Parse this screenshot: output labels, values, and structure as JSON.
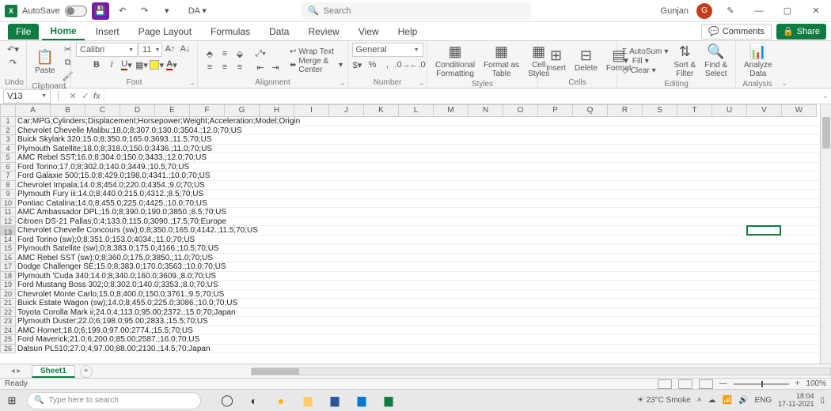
{
  "titlebar": {
    "autosave_label": "AutoSave",
    "autosave_state": "Off",
    "doc_name": "DA ▾",
    "search_placeholder": "Search",
    "user_name": "Gunjan",
    "user_initial": "G"
  },
  "tabs": {
    "file": "File",
    "items": [
      "Home",
      "Insert",
      "Page Layout",
      "Formulas",
      "Data",
      "Review",
      "View",
      "Help"
    ],
    "active": "Home",
    "comments": "Comments",
    "share": "Share"
  },
  "ribbon": {
    "undo": {
      "label": "Undo"
    },
    "clipboard": {
      "paste": "Paste",
      "label": "Clipboard"
    },
    "font": {
      "name": "Calibri",
      "size": "11",
      "label": "Font"
    },
    "alignment": {
      "wrap": "Wrap Text",
      "merge": "Merge & Center",
      "label": "Alignment"
    },
    "number": {
      "format": "General",
      "label": "Number"
    },
    "styles": {
      "cond": "Conditional\nFormatting",
      "table": "Format as\nTable",
      "cell": "Cell\nStyles",
      "label": "Styles"
    },
    "cells": {
      "insert": "Insert",
      "delete": "Delete",
      "format": "Format",
      "label": "Cells"
    },
    "editing": {
      "sum": "AutoSum",
      "fill": "Fill",
      "clear": "Clear",
      "sort": "Sort &\nFilter",
      "find": "Find &\nSelect",
      "label": "Editing"
    },
    "analysis": {
      "analyze": "Analyze\nData",
      "label": "Analysis"
    }
  },
  "fxbar": {
    "name": "V13",
    "fx": "fx"
  },
  "columns": [
    "A",
    "B",
    "C",
    "D",
    "E",
    "F",
    "G",
    "H",
    "I",
    "J",
    "K",
    "L",
    "M",
    "N",
    "O",
    "P",
    "Q",
    "R",
    "S",
    "T",
    "U",
    "V",
    "W"
  ],
  "rows": [
    "Car;MPG;Cylinders;Displacement;Horsepower;Weight;Acceleration;Model;Origin",
    "Chevrolet Chevelle Malibu;18.0;8;307.0;130.0;3504.;12.0;70;US",
    "Buick Skylark 320;15.0;8;350.0;165.0;3693.;11.5;70;US",
    "Plymouth Satellite;18.0;8;318.0;150.0;3436.;11.0;70;US",
    "AMC Rebel SST;16.0;8;304.0;150.0;3433.;12.0;70;US",
    "Ford Torino;17.0;8;302.0;140.0;3449.;10.5;70;US",
    "Ford Galaxie 500;15.0;8;429.0;198.0;4341.;10.0;70;US",
    "Chevrolet Impala;14.0;8;454.0;220.0;4354.;9.0;70;US",
    "Plymouth Fury iii;14.0;8;440.0;215.0;4312.;8.5;70;US",
    "Pontiac Catalina;14.0;8;455.0;225.0;4425.;10.0;70;US",
    "AMC Ambassador DPL;15.0;8;390.0;190.0;3850.;8.5;70;US",
    "Citroen DS-21 Pallas;0;4;133.0;115.0;3090.;17.5;70;Europe",
    "Chevrolet Chevelle Concours (sw);0;8;350.0;165.0;4142.;11.5;70;US",
    "Ford Torino (sw);0;8;351.0;153.0;4034.;11.0;70;US",
    "Plymouth Satellite (sw);0;8;383.0;175.0;4166.;10.5;70;US",
    "AMC Rebel SST (sw);0;8;360.0;175.0;3850.;11.0;70;US",
    "Dodge Challenger SE;15.0;8;383.0;170.0;3563.;10.0;70;US",
    "Plymouth 'Cuda 340;14.0;8;340.0;160.0;3609.;8.0;70;US",
    "Ford Mustang Boss 302;0;8;302.0;140.0;3353.;8.0;70;US",
    "Chevrolet Monte Carlo;15.0;8;400.0;150.0;3761.;9.5;70;US",
    "Buick Estate Wagon (sw);14.0;8;455.0;225.0;3086.;10.0;70;US",
    "Toyota Corolla Mark ii;24.0;4;113.0;95.00;2372.;15.0;70;Japan",
    "Plymouth Duster;22.0;6;198.0;95.00;2833.;15.5;70;US",
    "AMC Hornet;18.0;6;199.0;97.00;2774.;15.5;70;US",
    "Ford Maverick;21.0;6;200.0;85.00;2587.;16.0;70;US",
    "Datsun PL510;27.0;4;97.00;88.00;2130.;14.5;70;Japan"
  ],
  "active_cell": {
    "col": 21,
    "row": 13
  },
  "sheetbar": {
    "sheet": "Sheet1"
  },
  "statusbar": {
    "ready": "Ready",
    "zoom": "100%"
  },
  "taskbar": {
    "search": "Type here to search",
    "weather": "23°C Smoke",
    "lang": "ENG",
    "time": "18:04",
    "date": "17-11-2021"
  }
}
